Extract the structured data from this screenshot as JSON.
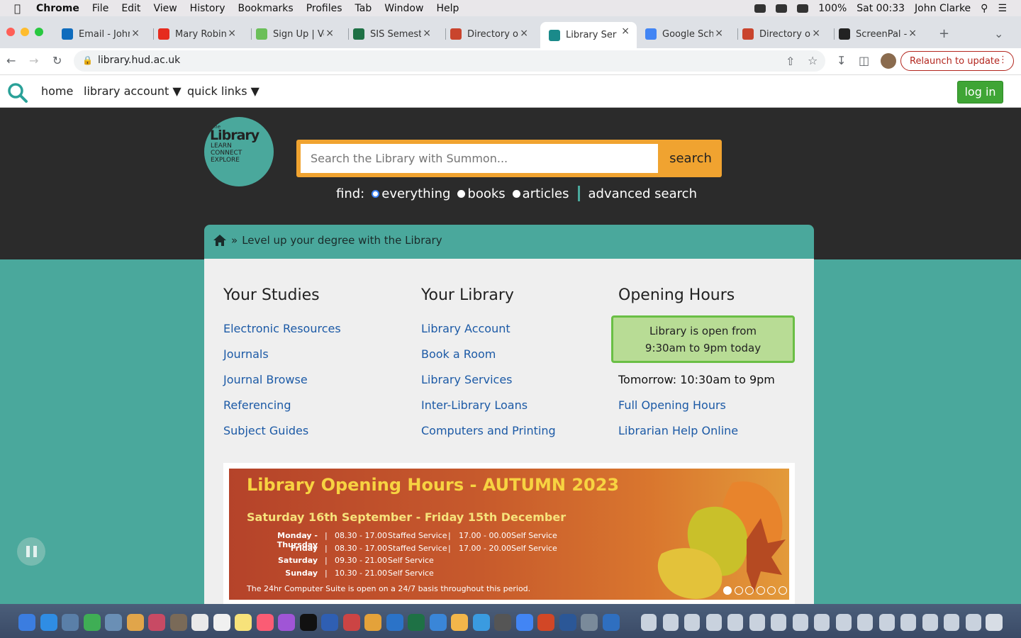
{
  "menubar": {
    "app": "Chrome",
    "items": [
      "File",
      "Edit",
      "View",
      "History",
      "Bookmarks",
      "Profiles",
      "Tab",
      "Window",
      "Help"
    ],
    "battery": "100%",
    "clock": "Sat 00:33",
    "user": "John Clarke"
  },
  "tabs": [
    {
      "title": "Email - John",
      "color": "#0f6cbd"
    },
    {
      "title": "Mary Robins",
      "color": "#e62b1e"
    },
    {
      "title": "Sign Up | Vo",
      "color": "#6bbf59"
    },
    {
      "title": "SIS Semeste",
      "color": "#1e7145"
    },
    {
      "title": "Directory of",
      "color": "#c9442d"
    },
    {
      "title": "Library Serv",
      "color": "#1a8a8a",
      "active": true
    },
    {
      "title": "Google Scho",
      "color": "#4285f4"
    },
    {
      "title": "Directory of",
      "color": "#c9442d"
    },
    {
      "title": "ScreenPal -",
      "color": "#222222"
    }
  ],
  "toolbar": {
    "url": "library.hud.ac.uk",
    "relaunch": "Relaunch to update"
  },
  "sitenav": {
    "home": "home",
    "account": "library account ▼",
    "quick": "quick links ▼",
    "login": "log in"
  },
  "logo": {
    "small": "The",
    "main": "Library",
    "lines": [
      "LEARN",
      "CONNECT",
      "EXPLORE"
    ]
  },
  "search": {
    "placeholder": "Search the Library with Summon...",
    "button": "search",
    "find_label": "find:",
    "options": [
      "everything",
      "books",
      "articles"
    ],
    "advanced": "advanced search"
  },
  "breadcrumb": {
    "sep": "»",
    "text": "Level up your degree with the Library"
  },
  "columns": {
    "studies": {
      "title": "Your Studies",
      "links": [
        "Electronic Resources",
        "Journals",
        "Journal Browse",
        "Referencing",
        "Subject Guides"
      ]
    },
    "library": {
      "title": "Your Library",
      "links": [
        "Library Account",
        "Book a Room",
        "Library Services",
        "Inter-Library Loans",
        "Computers and Printing"
      ]
    },
    "hours": {
      "title": "Opening Hours",
      "today_line1": "Library is open from",
      "today_line2": "9:30am to 9pm today",
      "tomorrow": "Tomorrow: 10:30am to 9pm",
      "links": [
        "Full Opening Hours",
        "Librarian Help Online"
      ]
    }
  },
  "banner": {
    "title": "Library Opening Hours - AUTUMN 2023",
    "subtitle": "Saturday 16th September - Friday 15th December",
    "rows": [
      {
        "day": "Monday - Thursday",
        "a": "08.30 - 17.00",
        "b": "Staffed Service",
        "c": "17.00 - 00.00",
        "d": "Self Service"
      },
      {
        "day": "Friday",
        "a": "08.30 - 17.00",
        "b": "Staffed Service",
        "c": "17.00 - 20.00",
        "d": "Self Service"
      },
      {
        "day": "Saturday",
        "a": "09.30 - 21.00",
        "b": "Self Service",
        "c": "",
        "d": ""
      },
      {
        "day": "Sunday",
        "a": "10.30 - 21.00",
        "b": "Self Service",
        "c": "",
        "d": ""
      }
    ],
    "note": "The 24hr Computer Suite is open on a 24/7 basis throughout this period.",
    "slide_count": 6,
    "active_slide": 1
  }
}
